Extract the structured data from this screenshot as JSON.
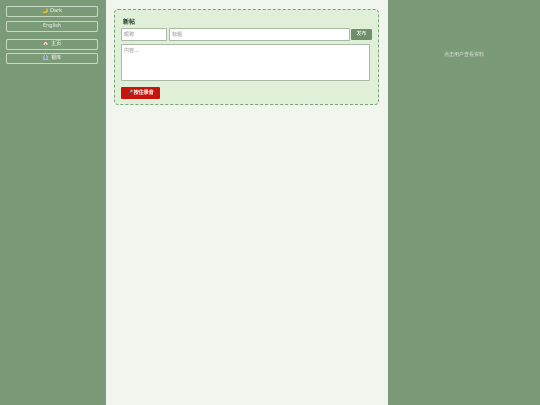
{
  "sidebar": {
    "theme_icon": "moon-icon",
    "theme_label": "Dark",
    "language_label": "English",
    "nav": [
      {
        "icon": "house-icon",
        "glyph": "🏠",
        "label": "主页"
      },
      {
        "icon": "bank-icon",
        "glyph": "🏦",
        "label": "银库"
      }
    ]
  },
  "composer": {
    "title": "新帖",
    "nickname_placeholder": "昵称",
    "title_placeholder": "标题",
    "content_placeholder": "内容...",
    "publish_label": "发布",
    "record_icon": "microphone-icon",
    "record_label": "按住录音"
  },
  "profile_panel": {
    "hint": "点击用户查看资料"
  },
  "colors": {
    "sidebar_bg": "#7b9a78",
    "main_bg": "#f0f5ee",
    "composer_bg": "#e0efd8",
    "publish_bg": "#6f8f6b",
    "record_bg": "#c8150c"
  }
}
